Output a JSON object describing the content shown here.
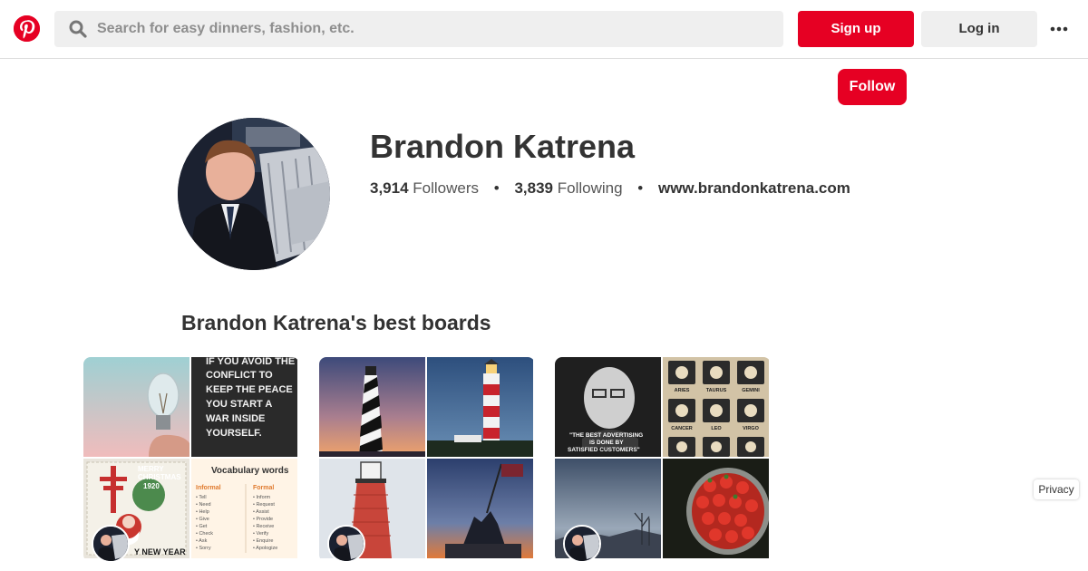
{
  "header": {
    "logo": "pinterest-logo",
    "search_placeholder": "Search for easy dinners, fashion, etc.",
    "signup_label": "Sign up",
    "login_label": "Log in",
    "more_icon": "more-dots-icon"
  },
  "follow_label": "Follow",
  "profile": {
    "name": "Brandon Katrena",
    "followers_count": "3,914",
    "followers_label": "Followers",
    "following_count": "3,839",
    "following_label": "Following",
    "separator": "•",
    "website": "www.brandonkatrena.com"
  },
  "boards_title": "Brandon Katrena's best boards",
  "boards": [
    {
      "tiles": [
        {
          "image": "light bulb on pink background"
        },
        {
          "quote_lines": [
            "IF YOU AVOID THE",
            "CONFLICT TO",
            "KEEP THE PEACE",
            "YOU START A",
            "WAR INSIDE",
            "YOURSELF."
          ]
        },
        {
          "stamp_lines": [
            "MERRY",
            "CHRISTMAS",
            "1920",
            "Y NEW YEAR"
          ]
        },
        {
          "title": "Vocabulary words",
          "informal_header": "Informal",
          "formal_header": "Formal",
          "informal": [
            "• Tell",
            "• Need",
            "• Help",
            "• Give",
            "• Get",
            "• Check",
            "• Ask",
            "• Sorry"
          ],
          "formal": [
            "• Inform",
            "• Request",
            "• Assist",
            "• Provide",
            "• Receive",
            "• Verify",
            "• Enquire",
            "• Apologize"
          ]
        }
      ]
    },
    {
      "tiles": [
        {
          "image": "striped lighthouse at dusk"
        },
        {
          "image": "red and white lighthouse"
        },
        {
          "image": "red brick lighthouse"
        },
        {
          "image": "iwo jima memorial at sunset"
        }
      ]
    },
    {
      "tiles": [
        {
          "caption_lines": [
            "\"THE BEST ADVERTISING",
            "IS DONE BY",
            "SATISFIED CUSTOMERS\""
          ]
        },
        {
          "zodiac": [
            "ARIES",
            "TAURUS",
            "GEMINI",
            "CANCER",
            "LEO",
            "VIRGO"
          ]
        },
        {
          "image": "winter sky over trees"
        },
        {
          "image": "bowl of strawberries"
        }
      ]
    }
  ],
  "privacy_label": "Privacy",
  "colors": {
    "brand_red": "#e60023",
    "button_gray": "#efefef"
  }
}
